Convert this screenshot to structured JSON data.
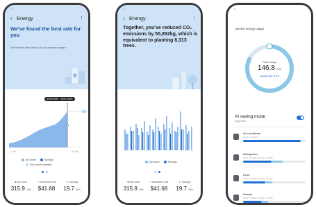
{
  "colors": {
    "accent": "#1f6fd1",
    "light_blue": "#8cc7e8",
    "header_bg": "#cfe3f8",
    "bezel": "#3a3a3a"
  },
  "screen1": {
    "title": "Energy",
    "headline": "We've found the best rate for you",
    "subline": "See the best rates based on your personal usage >",
    "tooltip": "315.9 kWh · 148.0 kWh",
    "legend": [
      "My home",
      "Savings",
      "Full month estimate"
    ],
    "stats": [
      {
        "label": "My home",
        "value": "315.9",
        "unit": "kWh"
      },
      {
        "label": "Estimated cost",
        "value": "$41.68",
        "unit": ""
      },
      {
        "label": "Savings",
        "value": "19.7",
        "unit": "kWh"
      }
    ]
  },
  "screen2": {
    "title": "Energy",
    "headline": "Together, you've reduced CO₂ emissions by 55,892kg, which is equivalent to planting 8,313 trees.",
    "legend": [
      "My home",
      "Savings"
    ],
    "stats": [
      {
        "label": "My home",
        "value": "315.9",
        "unit": "kWh"
      },
      {
        "label": "Estimated cost",
        "value": "$41.68",
        "unit": ""
      },
      {
        "label": "Savings",
        "value": "19.7",
        "unit": "kWh"
      }
    ]
  },
  "screen3": {
    "section_title": "Device energy usage",
    "total_label": "Total usage",
    "total_value": "146.8",
    "total_unit": "kWh",
    "saving_note": "Saving rate: 4.4%",
    "total_percent": 0.82,
    "ai_title": "AI saving mode",
    "ai_sub": "Supported",
    "ai_enabled": true,
    "devices": [
      {
        "name": "Air conditioner",
        "meta": "Used: 32.3 kWh",
        "icon": "air-conditioner-icon",
        "fill": 0.92,
        "saving": 0.0
      },
      {
        "name": "Refrigerator",
        "meta": "Used: 22 kWh  |  Saving: 3.7 kWh",
        "icon": "refrigerator-icon",
        "fill": 0.45,
        "saving": 0.18
      },
      {
        "name": "Dryer",
        "meta": "Used: 18 kWh  |  Saving: 2.5 kWh",
        "icon": "dryer-icon",
        "fill": 0.35,
        "saving": 0.12
      },
      {
        "name": "Washer",
        "meta": "Used: 15 kWh  |  Saving: 2.3 kWh",
        "icon": "washer-icon",
        "fill": 0.3,
        "saving": 0.1
      }
    ]
  }
}
